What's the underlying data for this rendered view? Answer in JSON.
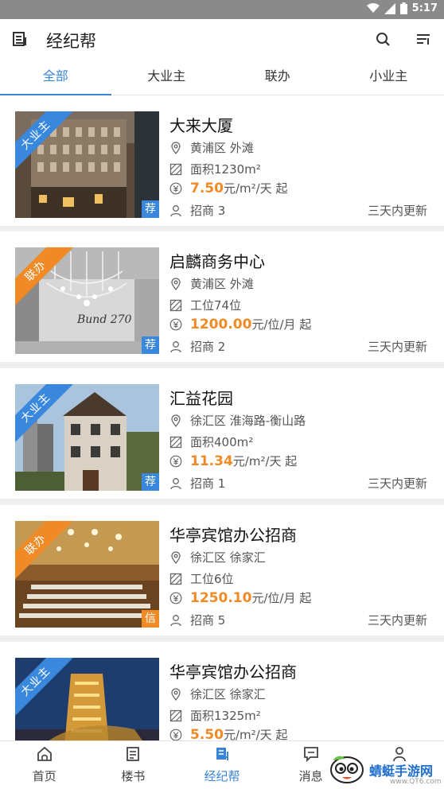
{
  "status_bar": {
    "time": "5:17"
  },
  "app_bar": {
    "title": "经纪帮"
  },
  "tabs": [
    {
      "label": "全部",
      "active": true
    },
    {
      "label": "大业主",
      "active": false
    },
    {
      "label": "联办",
      "active": false
    },
    {
      "label": "小业主",
      "active": false
    }
  ],
  "listings": [
    {
      "ribbon": "大业主",
      "ribbon_color": "#3a88dd",
      "badge": "荐",
      "badge_color": "#3a88dd",
      "name": "大来大厦",
      "location": "黄浦区 外滩",
      "area": "面积1230m²",
      "price": "7.50",
      "price_unit": "元/m²/天 起",
      "agents": "招商 3",
      "update": "三天内更新"
    },
    {
      "ribbon": "联办",
      "ribbon_color": "#f08a26",
      "badge": "荐",
      "badge_color": "#3a88dd",
      "name": "启麟商务中心",
      "location": "黄浦区 外滩",
      "area": "工位74位",
      "price": "1200.00",
      "price_unit": "元/位/月 起",
      "agents": "招商 2",
      "update": "三天内更新"
    },
    {
      "ribbon": "大业主",
      "ribbon_color": "#3a88dd",
      "badge": "荐",
      "badge_color": "#3a88dd",
      "name": "汇益花园",
      "location": "徐汇区 淮海路-衡山路",
      "area": "面积400m²",
      "price": "11.34",
      "price_unit": "元/m²/天 起",
      "agents": "招商 1",
      "update": "三天内更新"
    },
    {
      "ribbon": "联办",
      "ribbon_color": "#f08a26",
      "badge": "信",
      "badge_color": "#f08a26",
      "name": "华亭宾馆办公招商",
      "location": "徐汇区 徐家汇",
      "area": "工位6位",
      "price": "1250.10",
      "price_unit": "元/位/月 起",
      "agents": "招商 5",
      "update": "三天内更新"
    },
    {
      "ribbon": "大业主",
      "ribbon_color": "#3a88dd",
      "badge": "",
      "badge_color": "#3a88dd",
      "name": "华亭宾馆办公招商",
      "location": "徐汇区 徐家汇",
      "area": "面积1325m²",
      "price": "5.50",
      "price_unit": "元/m²/天 起",
      "agents": "",
      "update": ""
    }
  ],
  "bottom_nav": [
    {
      "label": "首页",
      "icon": "home-icon",
      "active": false
    },
    {
      "label": "楼书",
      "icon": "book-icon",
      "active": false
    },
    {
      "label": "经纪帮",
      "icon": "broker-icon",
      "active": true
    },
    {
      "label": "消息",
      "icon": "message-icon",
      "active": false
    },
    {
      "label": "",
      "icon": "profile-icon",
      "active": false
    }
  ],
  "watermark": {
    "text": "蜻蜓手游网",
    "url": "www.QT6.com"
  },
  "colors": {
    "accent": "#3a84d8",
    "price": "#f08a26",
    "ribbon_blue": "#3a88dd",
    "ribbon_orange": "#f08a26"
  }
}
